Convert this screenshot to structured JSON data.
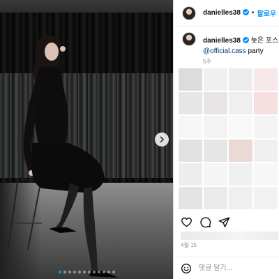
{
  "header": {
    "username": "danielles38",
    "separator": "•",
    "follow_label": "팔로우"
  },
  "caption": {
    "username": "danielles38",
    "text": "늦은 포스팅",
    "mention": "@official.cass",
    "text_after": "party",
    "time": "5주"
  },
  "carousel": {
    "slide_count": 12,
    "active_index": 0
  },
  "post": {
    "date": "4월 15"
  },
  "comment": {
    "placeholder": "댓글 달기..."
  },
  "colors": {
    "accent": "#0095f6",
    "verified": "#0095f6",
    "mention": "#00376b",
    "muted": "#8e8e8e"
  },
  "icons": [
    "verified-badge-icon",
    "chevron-right-icon",
    "heart-icon",
    "comment-icon",
    "share-icon",
    "emoji-icon"
  ]
}
